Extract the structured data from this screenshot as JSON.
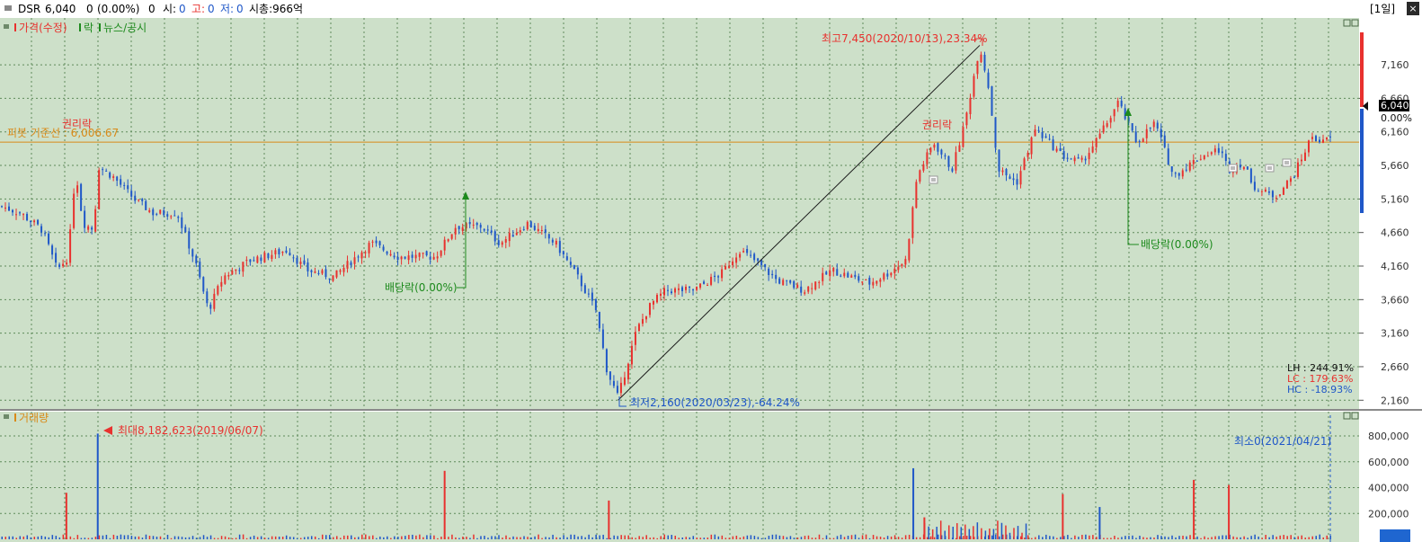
{
  "header": {
    "symbol": "DSR",
    "price": "6,040",
    "change": "0",
    "change_pct": "(0.00%)",
    "volume": "0",
    "open_label": "시:",
    "open_value": "0",
    "high_label": "고:",
    "high_value": "0",
    "low_label": "저:",
    "low_value": "0",
    "mcap": "시총:966억",
    "period_button": "[1일]"
  },
  "price_panel": {
    "legend_price": "가격(수정)",
    "legend_drop": "락",
    "legend_news": "뉴스/공시",
    "rights_label": "권리락",
    "dividend_label_left": "배당락(0.00%)",
    "dividend_label_right": "배당락(0.00%)",
    "high_annotation": "최고7,450(2020/10/13),23.34%",
    "low_annotation": "최저2,160(2020/03/23),-64.24%",
    "baseline_label": "피봇 기준선 : 6,006.67",
    "baseline_value": 6006.67,
    "current_price_tag": "6,040",
    "current_pct_tag": "0.00%",
    "stats_lh": "LH : 244.91%",
    "stats_lc": "LC : 179.63%",
    "stats_hc": "HC : -18.93%"
  },
  "volume_panel": {
    "title": "거래량",
    "max_annotation": "최대8,182,623(2019/06/07)",
    "min_annotation": "최소0(2021/04/21)"
  },
  "colors": {
    "background": "#cde0c9",
    "grid": "#5f8a5a",
    "up": "#e8312e",
    "down": "#1f57c8",
    "baseline": "#d98a18",
    "dividend": "#1d8a1d",
    "axis_text": "#333333"
  },
  "chart_data": {
    "type": "candlestick",
    "title": "",
    "y_ticks": [
      2160,
      2660,
      3160,
      3660,
      4160,
      4660,
      5160,
      5660,
      6160,
      6660,
      7160
    ],
    "y_tick_labels": [
      "2,160",
      "2,660",
      "3,160",
      "3,660",
      "4,160",
      "4,660",
      "5,160",
      "5,660",
      "6,160",
      "6,660",
      "7,160"
    ],
    "ylim": [
      2070,
      7590
    ],
    "volume_ticks": [
      200000,
      400000,
      600000,
      800000
    ],
    "volume_tick_labels": [
      "200,000",
      "400,000",
      "600,000",
      "800,000"
    ],
    "volume_ylim": [
      0,
      960000
    ],
    "candle_count": 370,
    "trend_line": {
      "from": {
        "date": "2020/03/23",
        "price": 2160
      },
      "to": {
        "date": "2020/10/13",
        "price": 7450
      }
    },
    "highest": {
      "date": "2020/10/13",
      "price": 7450,
      "pct": 23.34
    },
    "lowest": {
      "date": "2020/03/23",
      "price": 2160,
      "pct": -64.24
    },
    "max_volume": {
      "date": "2019/06/07",
      "value": 8182623
    },
    "min_volume": {
      "date": "2021/04/21",
      "value": 0
    },
    "close_path": [
      [
        0,
        5050
      ],
      [
        10,
        4950
      ],
      [
        22,
        4700
      ],
      [
        30,
        4100
      ],
      [
        36,
        4300
      ],
      [
        40,
        5600
      ],
      [
        44,
        4800
      ],
      [
        50,
        4700
      ],
      [
        52,
        5650
      ],
      [
        60,
        5500
      ],
      [
        72,
        5150
      ],
      [
        82,
        4950
      ],
      [
        95,
        4950
      ],
      [
        105,
        4200
      ],
      [
        112,
        3500
      ],
      [
        120,
        4000
      ],
      [
        135,
        4250
      ],
      [
        155,
        4400
      ],
      [
        165,
        4100
      ],
      [
        180,
        4000
      ],
      [
        200,
        4500
      ],
      [
        215,
        4300
      ],
      [
        235,
        4300
      ],
      [
        246,
        4750
      ],
      [
        260,
        4750
      ],
      [
        270,
        4500
      ],
      [
        285,
        4800
      ],
      [
        300,
        4500
      ],
      [
        312,
        4000
      ],
      [
        322,
        3500
      ],
      [
        328,
        2600
      ],
      [
        334,
        2200
      ],
      [
        344,
        3200
      ],
      [
        352,
        3600
      ],
      [
        360,
        3800
      ],
      [
        375,
        3800
      ],
      [
        390,
        4050
      ],
      [
        400,
        4400
      ],
      [
        410,
        4200
      ],
      [
        420,
        3950
      ],
      [
        435,
        3800
      ],
      [
        450,
        4100
      ],
      [
        470,
        3900
      ],
      [
        480,
        4050
      ],
      [
        490,
        4250
      ],
      [
        496,
        5500
      ],
      [
        505,
        6000
      ],
      [
        515,
        5600
      ],
      [
        522,
        6300
      ],
      [
        530,
        7450
      ],
      [
        535,
        6800
      ],
      [
        540,
        5600
      ],
      [
        550,
        5400
      ],
      [
        560,
        6200
      ],
      [
        575,
        5800
      ],
      [
        585,
        5700
      ],
      [
        595,
        6100
      ],
      [
        605,
        6600
      ],
      [
        615,
        6000
      ],
      [
        625,
        6300
      ],
      [
        635,
        5500
      ],
      [
        650,
        5800
      ],
      [
        660,
        5900
      ],
      [
        665,
        5600
      ],
      [
        672,
        5700
      ],
      [
        680,
        5300
      ],
      [
        690,
        5200
      ],
      [
        700,
        5500
      ],
      [
        710,
        6100
      ],
      [
        716,
        6000
      ],
      [
        720,
        6080
      ]
    ],
    "volume_spikes": [
      {
        "at": 35,
        "value": 360000
      },
      {
        "at": 52,
        "value": 818262
      },
      {
        "at": 240,
        "value": 530000
      },
      {
        "at": 329,
        "value": 300000
      },
      {
        "at": 494,
        "value": 550000
      },
      {
        "at": 500,
        "value": 170000
      },
      {
        "at": 575,
        "value": 350000
      },
      {
        "at": 595,
        "value": 250000
      },
      {
        "at": 646,
        "value": 460000
      },
      {
        "at": 665,
        "value": 420000
      }
    ]
  }
}
